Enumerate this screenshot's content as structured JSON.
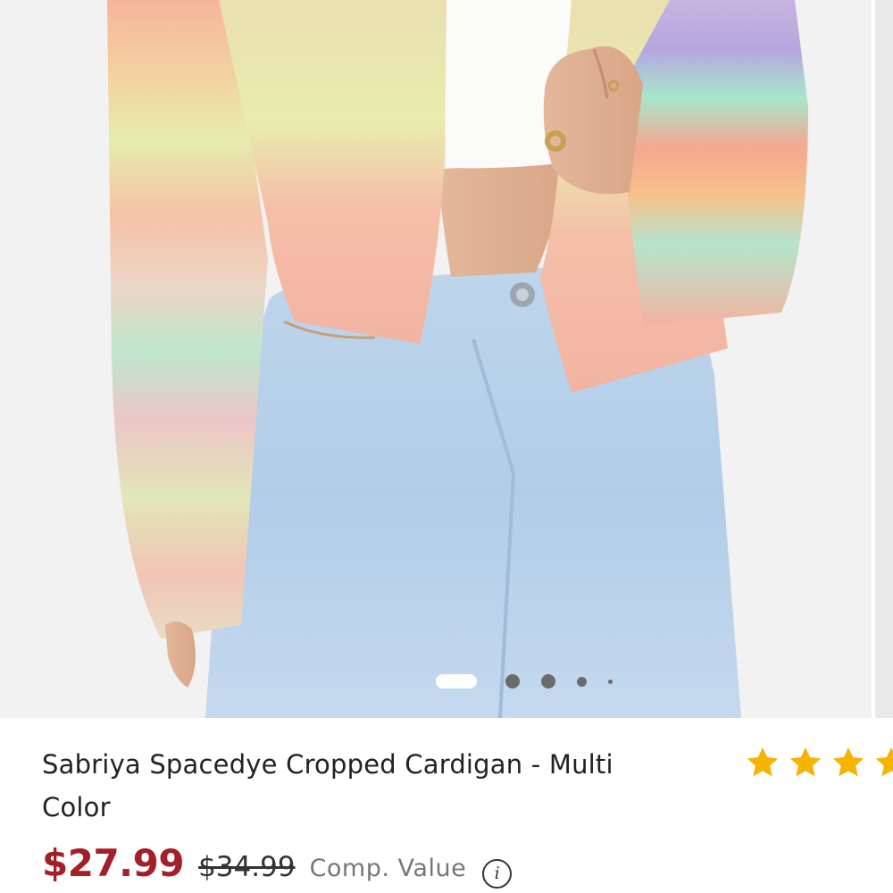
{
  "product": {
    "title": "Sabriya Spacedye Cropped Cardigan - Multi Color",
    "rating": {
      "stars_shown": 4,
      "star_color": "#F5B400"
    },
    "pricing": {
      "sale_price": "$27.99",
      "original_price": "$34.99",
      "comp_label": "Comp. Value",
      "sale_color": "#A32029",
      "info_icon": "info-icon"
    }
  },
  "gallery": {
    "image_alt": "Model wearing pastel spacedye cropped cardigan with light wash jeans",
    "dot_count": 5,
    "active_index": 1
  }
}
